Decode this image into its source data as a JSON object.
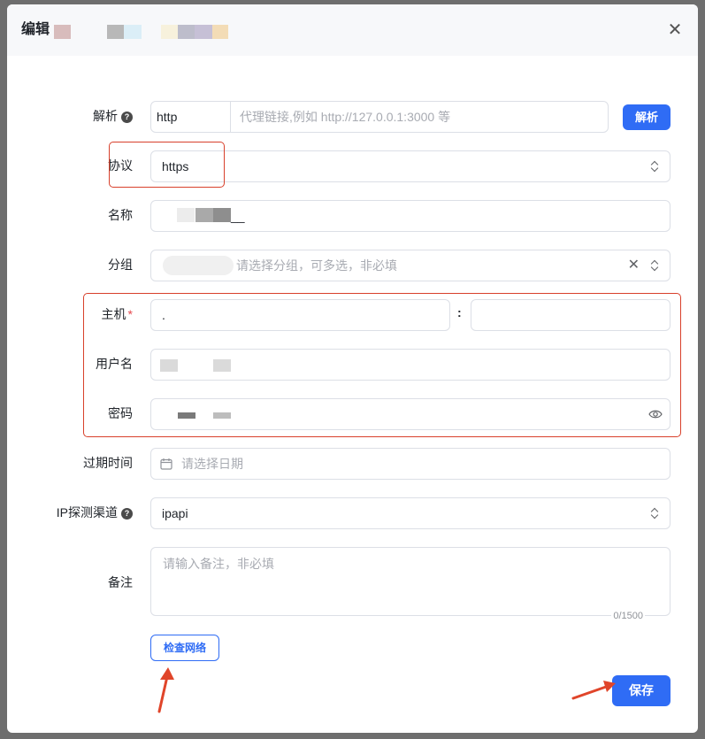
{
  "dialog": {
    "title": "编辑",
    "close_label": "✕"
  },
  "form": {
    "parse": {
      "label": "解析",
      "prefix_value": "http",
      "placeholder": "代理链接,例如 http://127.0.0.1:3000 等",
      "button": "解析"
    },
    "protocol": {
      "label": "协议",
      "value": "https"
    },
    "name": {
      "label": "名称",
      "value": "__"
    },
    "group": {
      "label": "分组",
      "placeholder": "请选择分组，可多选，非必填"
    },
    "host": {
      "label": "主机",
      "required_mark": "*",
      "host_value": ".",
      "separator": ":"
    },
    "username": {
      "label": "用户名"
    },
    "password": {
      "label": "密码"
    },
    "expire": {
      "label": "过期时间",
      "placeholder": "请选择日期"
    },
    "ip_channel": {
      "label": "IP探测渠道",
      "value": "ipapi"
    },
    "remark": {
      "label": "备注",
      "placeholder": "请输入备注，非必填",
      "counter": "0/1500"
    }
  },
  "actions": {
    "check_network": "检查网络",
    "save": "保存"
  },
  "colors": {
    "primary": "#2f6cf5",
    "annotation_red": "#d8402b"
  }
}
